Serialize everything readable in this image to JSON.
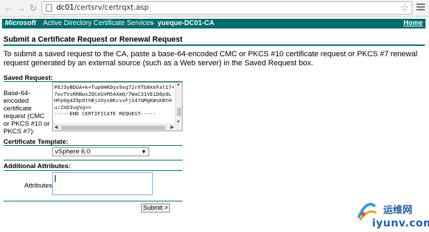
{
  "browser": {
    "url_host": "dc01",
    "url_path": "/certsrv/certrqxt.asp"
  },
  "header": {
    "brand": "Microsoft",
    "product": "Active Directory Certificate Services",
    "separator": "--",
    "ca_name": "yueque-DC01-CA",
    "home_link": "Home"
  },
  "page": {
    "title": "Submit a Certificate Request or Renewal Request",
    "intro": "To submit a saved request to the CA, paste a base-64-encoded CMC or PKCS #10 certificate request or PKCS #7 renewal request generated by an external source (such as a Web server) in the Saved Request box."
  },
  "saved_request": {
    "section_label": "Saved Request:",
    "field_label": "Base-64-encoded certificate request (CMC or PKCS #10 or PKCS #7):",
    "lines": [
      "P6J3yBDUA+k+Tup0HKDyx9xg72rXTb8keFal17+",
      "7ovTVsRRBwsZQCeGVM54XmQ/7WaC31VE1D6p9L",
      "HFpOg4Z9p9thBjzOyx8KcvvFj147GMgKWsKBtH",
      "u/ZnD3vgVg==",
      "-----END CERTIFICATE REQUEST-----"
    ]
  },
  "certificate_template": {
    "section_label": "Certificate Template:",
    "selected": "vSphere 6.0"
  },
  "additional_attributes": {
    "section_label": "Additional Attributes:",
    "attributes_label": "Attributes:",
    "value": ""
  },
  "submit_label": "Submit >",
  "watermark": {
    "site_name": "运维网",
    "url": "iyunv.com"
  },
  "colors": {
    "header_bg": "#006c6c",
    "rule": "#006c6c",
    "watermark": "#1f5fa8"
  }
}
